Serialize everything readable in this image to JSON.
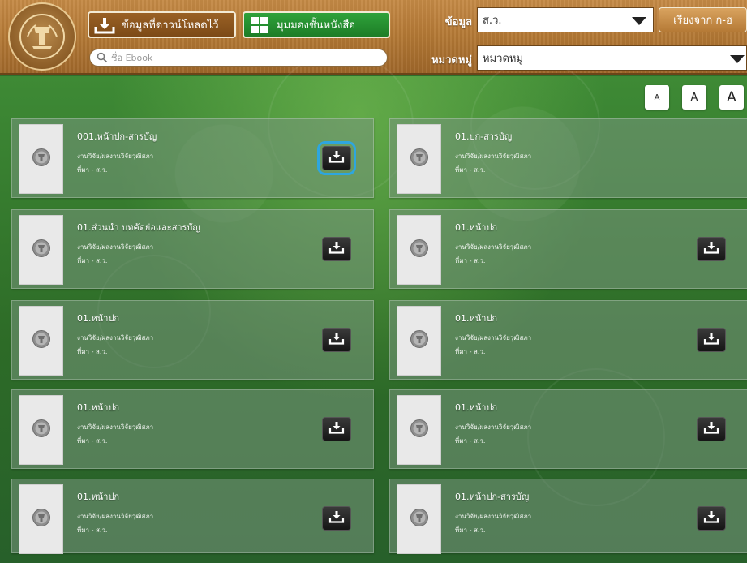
{
  "header": {
    "download_list_label": "ข้อมูลที่ดาวน์โหลดไว้",
    "bookshelf_label": "มุมมองชั้นหนังสือ",
    "search_placeholder": "ชื่อ Ebook",
    "data_label": "ข้อมูล",
    "data_value": "ส.ว.",
    "sort_label": "เรียงจาก ก-ฮ",
    "category_label": "หมวดหมู่",
    "category_value": "หมวดหมู่"
  },
  "font_size_buttons": [
    "A",
    "A",
    "A"
  ],
  "books": [
    {
      "title": "001.หน้าปก-สารบัญ",
      "category": "งานวิจัย/ผลงานวิจัยวุฒิสภา",
      "source": "ที่มา - ส.ว.",
      "has_download": true,
      "focused": true
    },
    {
      "title": "01.ปก-สารบัญ",
      "category": "งานวิจัย/ผลงานวิจัยวุฒิสภา",
      "source": "ที่มา - ส.ว.",
      "has_download": false,
      "focused": false
    },
    {
      "title": "01.ส่วนนำ บทคัดย่อและสารบัญ",
      "category": "งานวิจัย/ผลงานวิจัยวุฒิสภา",
      "source": "ที่มา - ส.ว.",
      "has_download": true,
      "focused": false
    },
    {
      "title": "01.หน้าปก",
      "category": "งานวิจัย/ผลงานวิจัยวุฒิสภา",
      "source": "ที่มา - ส.ว.",
      "has_download": true,
      "focused": false
    },
    {
      "title": "01.หน้าปก",
      "category": "งานวิจัย/ผลงานวิจัยวุฒิสภา",
      "source": "ที่มา - ส.ว.",
      "has_download": true,
      "focused": false
    },
    {
      "title": "01.หน้าปก",
      "category": "งานวิจัย/ผลงานวิจัยวุฒิสภา",
      "source": "ที่มา - ส.ว.",
      "has_download": true,
      "focused": false
    },
    {
      "title": "01.หน้าปก",
      "category": "งานวิจัย/ผลงานวิจัยวุฒิสภา",
      "source": "ที่มา - ส.ว.",
      "has_download": true,
      "focused": false
    },
    {
      "title": "01.หน้าปก",
      "category": "งานวิจัย/ผลงานวิจัยวุฒิสภา",
      "source": "ที่มา - ส.ว.",
      "has_download": true,
      "focused": false
    },
    {
      "title": "01.หน้าปก",
      "category": "งานวิจัย/ผลงานวิจัยวุฒิสภา",
      "source": "ที่มา - ส.ว.",
      "has_download": true,
      "focused": false
    },
    {
      "title": "01.หน้าปก-สารบัญ",
      "category": "งานวิจัย/ผลงานวิจัยวุฒิสภา",
      "source": "ที่มา - ส.ว.",
      "has_download": true,
      "focused": false
    }
  ]
}
